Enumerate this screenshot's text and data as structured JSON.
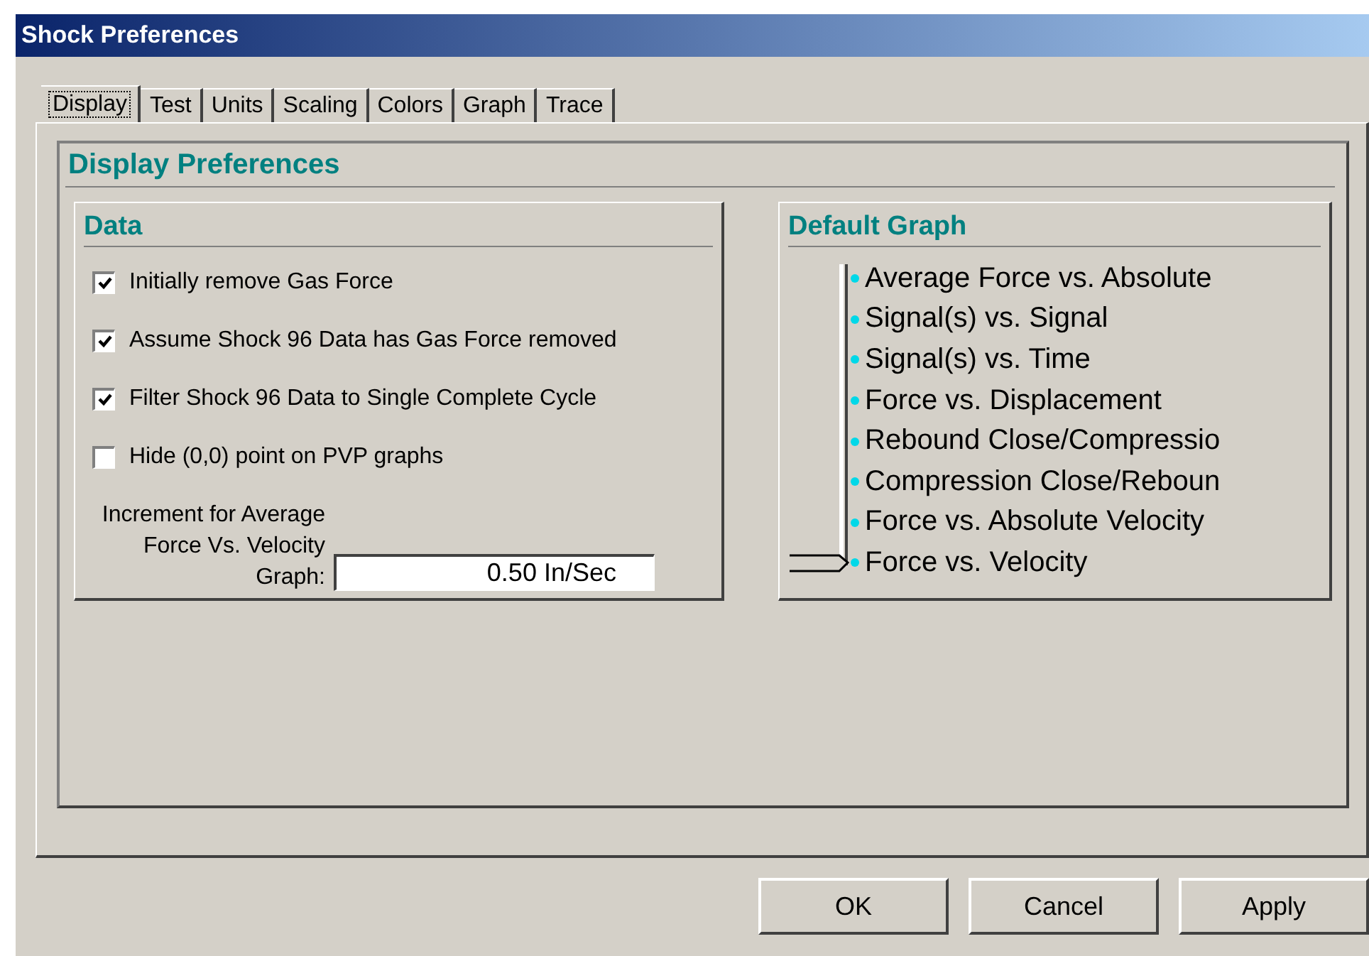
{
  "window": {
    "title": "Shock Preferences"
  },
  "tabs": [
    {
      "label": "Display",
      "selected": true
    },
    {
      "label": "Test",
      "selected": false
    },
    {
      "label": "Units",
      "selected": false
    },
    {
      "label": "Scaling",
      "selected": false
    },
    {
      "label": "Colors",
      "selected": false
    },
    {
      "label": "Graph",
      "selected": false
    },
    {
      "label": "Trace",
      "selected": false
    }
  ],
  "panel_title": "Display Preferences",
  "data_group": {
    "title": "Data",
    "options": [
      {
        "label": "Initially remove Gas Force",
        "checked": true
      },
      {
        "label": "Assume Shock 96 Data has Gas Force removed",
        "checked": true
      },
      {
        "label": "Filter Shock 96  Data to Single Complete Cycle",
        "checked": true
      },
      {
        "label": "Hide (0,0) point on PVP graphs",
        "checked": false
      }
    ],
    "increment": {
      "label": "Increment for Average Force Vs. Velocity Graph:",
      "value": "0.50 In/Sec"
    }
  },
  "default_graph": {
    "title": "Default Graph",
    "items": [
      {
        "label": "Average Force vs. Absolute",
        "selected": false
      },
      {
        "label": "Signal(s) vs. Signal",
        "selected": false
      },
      {
        "label": "Signal(s) vs. Time",
        "selected": false
      },
      {
        "label": "Force vs. Displacement",
        "selected": false
      },
      {
        "label": "Rebound Close/Compressio",
        "selected": false
      },
      {
        "label": "Compression Close/Reboun",
        "selected": false
      },
      {
        "label": "Force vs. Absolute Velocity",
        "selected": false
      },
      {
        "label": "Force vs. Velocity",
        "selected": true
      }
    ]
  },
  "buttons": [
    "OK",
    "Cancel",
    "Apply"
  ]
}
